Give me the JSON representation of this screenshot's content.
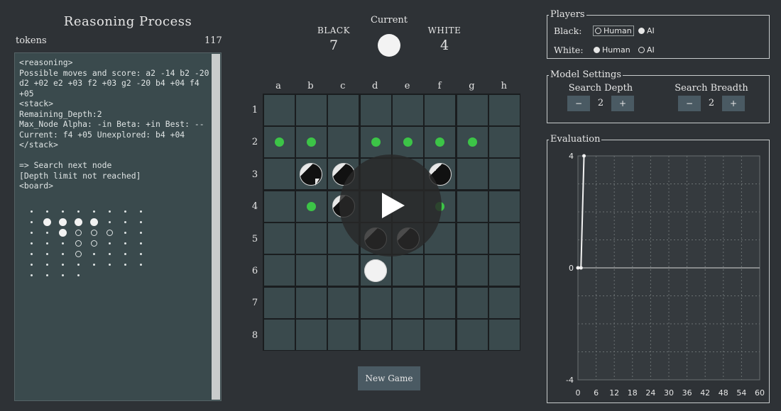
{
  "reasoning": {
    "title": "Reasoning Process",
    "tokens_label": "tokens",
    "tokens_value": "117",
    "text": "<reasoning>\nPossible moves and score: a2 -14 b2 -20 d2 +02 e2 +03 f2 +03 g2 -20 b4 +04 f4 +05\n<stack>\nRemaining_Depth:2\nMax_Node Alpha: -in Beta: +in Best: -- Current: f4 +05 Unexplored: b4 +04\n</stack>\n\n=> Search next node\n[Depth limit not reached]\n<board>",
    "board_rows": [
      "........",
      ".WWWW...",
      "..WBBB..",
      "...BB...",
      "...B....",
      "........",
      "....    "
    ]
  },
  "header": {
    "black_label": "BLACK",
    "black_score": "7",
    "white_label": "WHITE",
    "white_score": "4",
    "current_label": "Current",
    "current_player": "white"
  },
  "board": {
    "columns": [
      "a",
      "b",
      "c",
      "d",
      "e",
      "f",
      "g",
      "h"
    ],
    "rows": [
      "1",
      "2",
      "3",
      "4",
      "5",
      "6",
      "7",
      "8"
    ],
    "cells": [
      "........",
      "**.****.",
      ".BB..B..",
      ".*B..*..",
      "...BB...",
      "...W....",
      "........",
      "........"
    ],
    "legend": {
      "B": "black piece",
      "W": "white piece",
      "*": "legal move hint",
      ".": "empty"
    },
    "hint_color": "#3cc447"
  },
  "new_game_label": "New Game",
  "players": {
    "title": "Players",
    "black_label": "Black:",
    "white_label": "White:",
    "human_label": "Human",
    "ai_label": "AI",
    "black_selected": "Human",
    "white_selected": "Human"
  },
  "model_settings": {
    "title": "Model Settings",
    "search_depth_label": "Search Depth",
    "search_depth_value": "2",
    "search_breadth_label": "Search Breadth",
    "search_breadth_value": "2",
    "minus_label": "−",
    "plus_label": "+"
  },
  "evaluation": {
    "title": "Evaluation",
    "chart_data": {
      "type": "line",
      "x": [
        0,
        1,
        2
      ],
      "y": [
        0,
        0,
        4
      ],
      "ylim": [
        -4,
        4
      ],
      "xlim": [
        0,
        60
      ],
      "xticks": [
        0,
        6,
        12,
        18,
        24,
        30,
        36,
        42,
        48,
        54,
        60
      ],
      "yticks": [
        4,
        0,
        -4
      ],
      "grid": true
    }
  }
}
